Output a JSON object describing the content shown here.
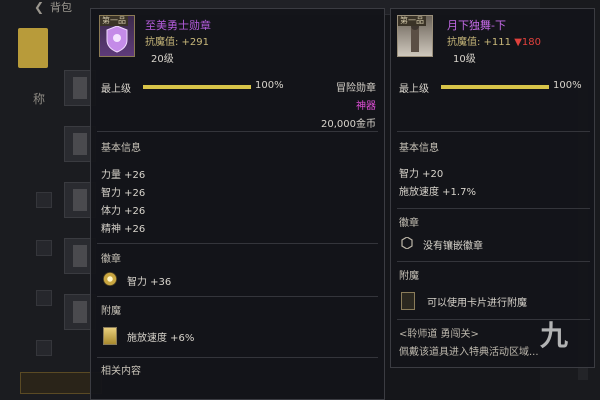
{
  "background": {
    "header_title": "背包",
    "character_label": "称"
  },
  "item1": {
    "tag": "第一品",
    "name": "至美勇士勋章",
    "stat": "抗魔值: +291",
    "level": "20级",
    "bar_label": "最上级",
    "bar_percent": "100%",
    "bar_fill": 1.0,
    "type_label": "冒险勋章",
    "rarity": "神器",
    "price": "20,000金币",
    "base_info_title": "基本信息",
    "attributes": [
      "力量 +26",
      "智力 +26",
      "体力 +26",
      "精神 +26"
    ],
    "badge_title": "徽章",
    "badge_value": "智力 +36",
    "enchant_title": "附魔",
    "enchant_value": "施放速度 +6%",
    "related_title": "相关内容"
  },
  "item2": {
    "tag": "第一品",
    "name": "月下独舞-下",
    "stat_prefix": "抗魔值: +111",
    "stat_diff": "▼180",
    "level": "10级",
    "bar_label": "最上级",
    "bar_percent": "100%",
    "bar_fill": 1.0,
    "base_info_title": "基本信息",
    "attributes": [
      "智力 +20",
      "施放速度 +1.7%"
    ],
    "badge_title": "徽章",
    "badge_value": "没有镶嵌徽章",
    "enchant_title": "附魔",
    "enchant_value": "可以使用卡片进行附魔",
    "note_title": "<聆师道 勇闯关>",
    "note_text": "佩戴该道具进入特典活动区域..."
  },
  "watermark": "九",
  "colors": {
    "rarity_purple": "#b45cdc",
    "artifact_pink": "#e04fd8",
    "bar_gold": "#d8c449",
    "down_red": "#e0413c"
  }
}
